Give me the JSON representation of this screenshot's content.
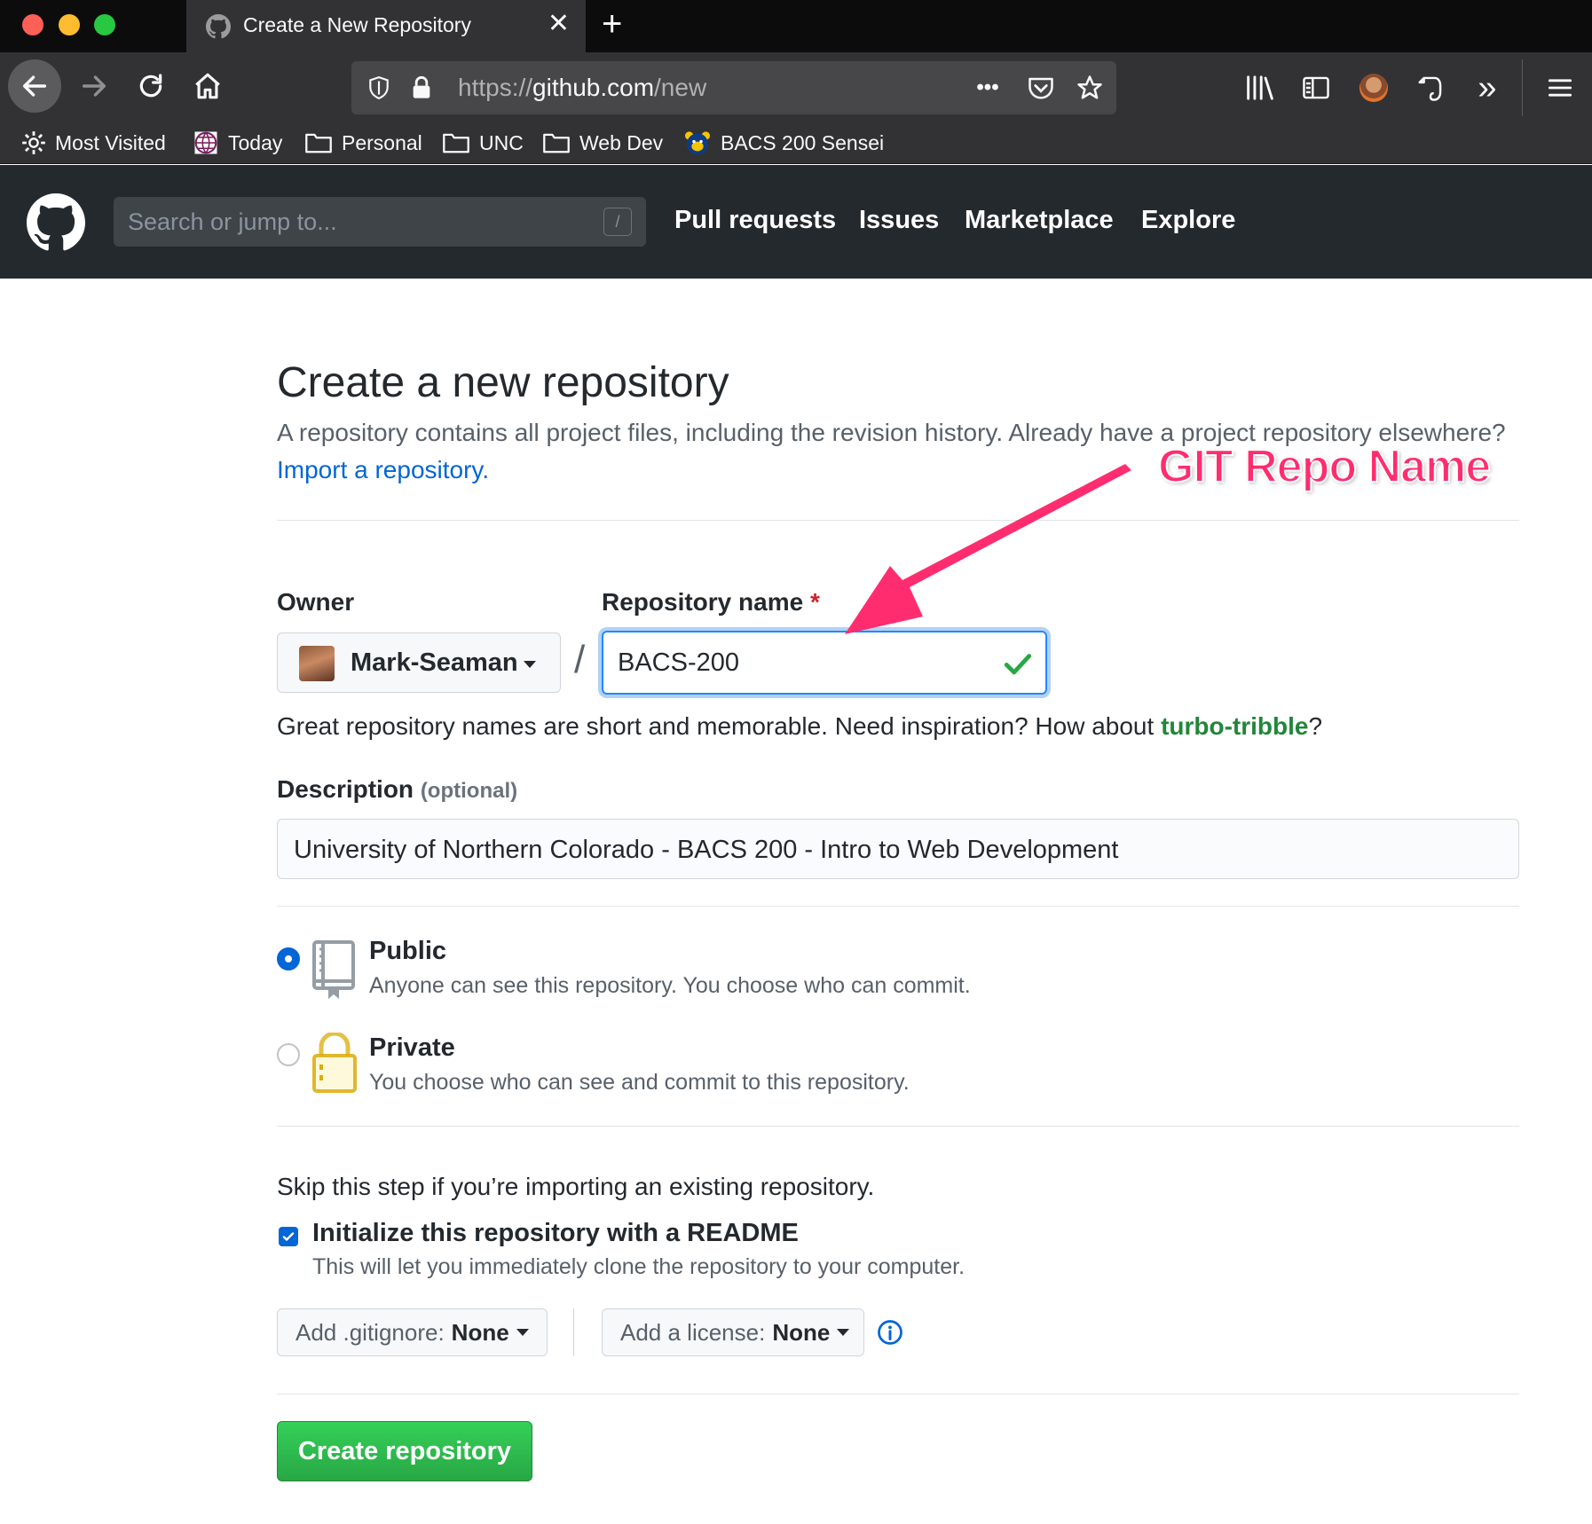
{
  "browser": {
    "tab_title": "Create a New Repository",
    "tab_close": "✕",
    "new_tab": "+",
    "url_prefix": "https://",
    "url_host": "github.com",
    "url_path": "/new",
    "url_menu": "•••",
    "overflow": "»",
    "bookmarks": [
      {
        "label": "Most Visited",
        "icon": "gear-icon"
      },
      {
        "label": "Today",
        "icon": "globe-icon"
      },
      {
        "label": "Personal",
        "icon": "folder-icon"
      },
      {
        "label": "UNC",
        "icon": "folder-icon"
      },
      {
        "label": "Web Dev",
        "icon": "folder-icon"
      },
      {
        "label": "BACS 200 Sensei",
        "icon": "bear-icon"
      }
    ]
  },
  "github_header": {
    "search_placeholder": "Search or jump to...",
    "search_shortcut": "/",
    "nav": [
      "Pull requests",
      "Issues",
      "Marketplace",
      "Explore"
    ]
  },
  "page": {
    "title": "Create a new repository",
    "subhead_text": "A repository contains all project files, including the revision history. Already have a project repository elsewhere?",
    "subhead_link": "Import a repository.",
    "owner_label": "Owner",
    "owner_name": "Mark-Seaman",
    "slash": "/",
    "repo_name_label": "Repository name",
    "required_mark": "*",
    "repo_name_value": "BACS-200",
    "inspiration_text": "Great repository names are short and memorable. Need inspiration? How about",
    "inspiration_suggestion": "turbo-tribble",
    "inspiration_end": "?",
    "description_label": "Description",
    "description_optional": "(optional)",
    "description_value": "University of Northern Colorado - BACS 200 - Intro to Web Development",
    "visibility": {
      "public_title": "Public",
      "public_desc": "Anyone can see this repository. You choose who can commit.",
      "private_title": "Private",
      "private_desc": "You choose who can see and commit to this repository.",
      "selected": "public"
    },
    "skip_text": "Skip this step if you’re importing an existing repository.",
    "readme_label": "Initialize this repository with a README",
    "readme_desc": "This will let you immediately clone the repository to your computer.",
    "readme_checked": true,
    "gitignore_prefix": "Add .gitignore:",
    "gitignore_value": "None",
    "license_prefix": "Add a license:",
    "license_value": "None",
    "create_button": "Create repository"
  },
  "annotation": {
    "text": "GIT Repo Name",
    "color": "#ff2d6f"
  },
  "colors": {
    "link": "#0366d6",
    "success": "#28a745",
    "suggestion": "#22863a",
    "header_bg": "#24292e"
  }
}
